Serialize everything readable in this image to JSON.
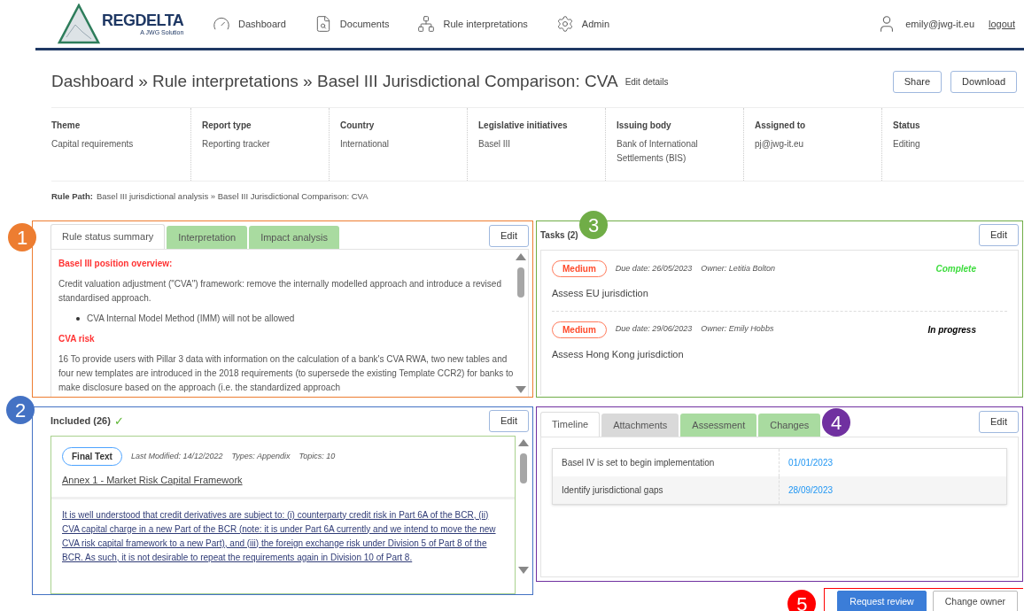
{
  "header": {
    "logo": {
      "name": "REGDELTA",
      "tagline": "A JWG Solution"
    },
    "nav": [
      {
        "label": "Dashboard"
      },
      {
        "label": "Documents"
      },
      {
        "label": "Rule interpretations"
      },
      {
        "label": "Admin"
      }
    ],
    "user": "emily@jwg-it.eu",
    "logout": "logout"
  },
  "page": {
    "title": "Dashboard » Rule interpretations » Basel III Jurisdictional Comparison: CVA",
    "edit_link": "Edit details",
    "actions": [
      "Share",
      "Download"
    ]
  },
  "details": [
    {
      "label": "Theme",
      "value": "Capital requirements"
    },
    {
      "label": "Report type",
      "value": "Reporting tracker"
    },
    {
      "label": "Country",
      "value": "International"
    },
    {
      "label": "Legislative initiatives",
      "value": "Basel III"
    },
    {
      "label": "Issuing body",
      "value": "Bank of International Settlements (BIS)"
    },
    {
      "label": "Assigned to",
      "value": "pj@jwg-it.eu"
    },
    {
      "label": "Status",
      "value": "Editing"
    }
  ],
  "rule_path": {
    "label": "Rule Path:",
    "value": "Basel III jurisdictional analysis » Basel III Jurisdictional Comparison: CVA"
  },
  "rule_panel": {
    "callout": {
      "label": "1",
      "color": "#ed7d31"
    },
    "tabs": [
      {
        "label": "Rule status summary",
        "selected": true,
        "color": "#ffffff"
      },
      {
        "label": "Interpretation",
        "selected": false,
        "color": "#a9dba0"
      },
      {
        "label": "Impact analysis",
        "selected": false,
        "color": "#a9dba0"
      }
    ],
    "edit": "Edit",
    "content": [
      {
        "kind": "heading",
        "text": "Basel III position overview:"
      },
      {
        "kind": "paragraph",
        "text": "Credit valuation adjustment (\"CVA\") framework: remove the internally modelled approach and introduce a revised standardised approach."
      },
      {
        "kind": "bullet",
        "text": "CVA Internal Model Method (IMM) will not be allowed"
      },
      {
        "kind": "heading",
        "text": "CVA risk"
      },
      {
        "kind": "paragraph",
        "text": "16 To provide users with Pillar 3 data with information on the calculation of a bank's CVA RWA, two new tables and four new templates are introduced in the 2018 requirements (to supersede the existing Template CCR2) for banks to make disclosure based on the approach (i.e. the standardized approach"
      }
    ]
  },
  "included_panel": {
    "callout": {
      "label": "2",
      "color": "#4472c4"
    },
    "title": "Included (26)",
    "check": "✓",
    "edit": "Edit",
    "document": {
      "badge": "Final Text",
      "meta": [
        "Last Modified: 14/12/2022",
        "Types: Appendix",
        "Topics: 10"
      ],
      "title": "Annex 1 - Market Risk Capital Framework",
      "excerpt": "It is well understood that credit derivatives are subject to: (i) counterparty credit risk in Part 6A of the BCR, (ii) CVA capital charge in a new Part of the BCR (note: it is under Part 6A currently and we intend to move the new CVA risk capital framework to a new Part), and (iii) the foreign exchange risk under Division 5 of Part 8 of the BCR. As such, it is not desirable to repeat the requirements again in Division 10 of Part 8."
    }
  },
  "tasks_panel": {
    "callout": {
      "label": "3",
      "color": "#70ad47"
    },
    "title": "Tasks (2)",
    "edit": "Edit",
    "tasks": [
      {
        "priority": "Medium",
        "due": "Due date: 26/05/2023",
        "owner": "Owner: Letitia Bolton",
        "status": "Complete",
        "color": "#3ddc3d",
        "name": "Assess EU jurisdiction"
      },
      {
        "priority": "Medium",
        "due": "Due date: 29/06/2023",
        "owner": "Owner: Emily Hobbs",
        "status": "In progress",
        "color": "#000000",
        "name": "Assess Hong Kong jurisdiction"
      }
    ]
  },
  "timeline_panel": {
    "callout": {
      "label": "4",
      "color": "#7030a0"
    },
    "tabs": [
      {
        "label": "Timeline",
        "selected": true,
        "color": "#ffffff"
      },
      {
        "label": "Attachments",
        "selected": false,
        "color": "#d9d9d9"
      },
      {
        "label": "Assessment",
        "selected": false,
        "color": "#a9dba0"
      },
      {
        "label": "Changes",
        "selected": false,
        "color": "#a9dba0"
      }
    ],
    "edit": "Edit",
    "rows": [
      {
        "event": "Basel IV is set to begin implementation",
        "date": "01/01/2023"
      },
      {
        "event": "Identify jurisdictional gaps",
        "date": "28/09/2023"
      }
    ]
  },
  "actions": {
    "callout": {
      "label": "5",
      "color": "#ff0000"
    },
    "buttons": [
      {
        "label": "Request review",
        "kind": "primary"
      },
      {
        "label": "Change owner",
        "kind": "secondary"
      }
    ]
  }
}
